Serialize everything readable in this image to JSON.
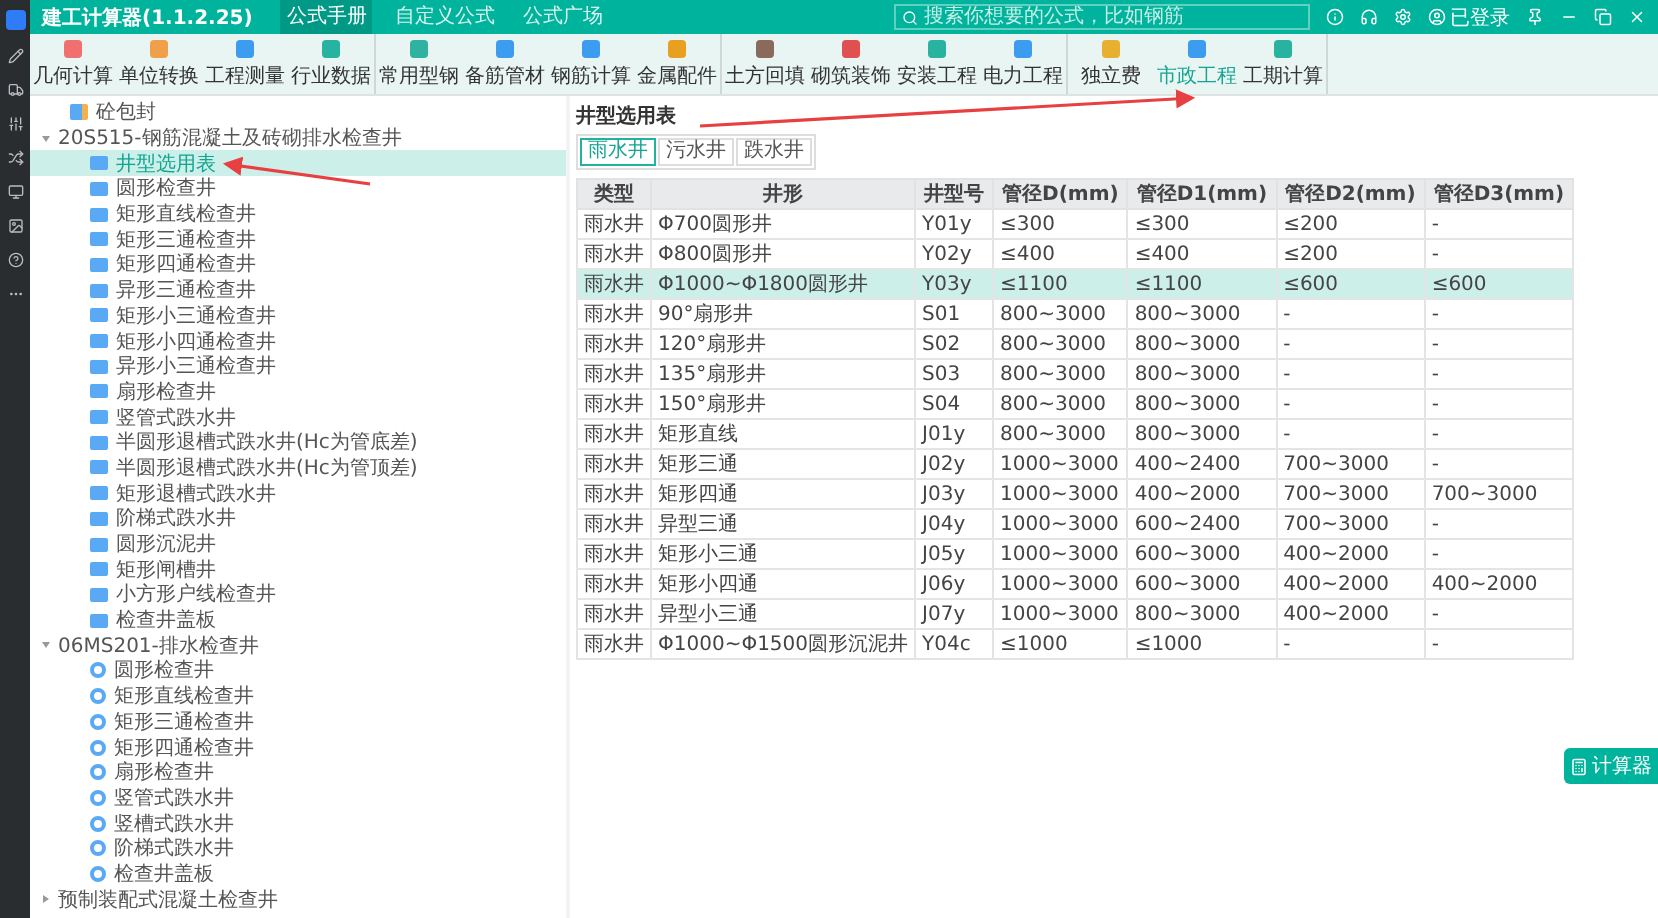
{
  "app": {
    "title": "建工计算器(1.1.2.25)",
    "nav_tabs": [
      {
        "label": "公式手册",
        "selected": true
      },
      {
        "label": "自定义公式",
        "selected": false
      },
      {
        "label": "公式广场",
        "selected": false
      }
    ],
    "search": {
      "placeholder": "搜索你想要的公式，比如钢筋"
    },
    "account": "已登录"
  },
  "toolbar": {
    "groups": [
      {
        "items": [
          {
            "label": "几何计算",
            "selected": false
          },
          {
            "label": "单位转换",
            "selected": false
          },
          {
            "label": "工程测量",
            "selected": false
          },
          {
            "label": "行业数据",
            "selected": false
          }
        ]
      },
      {
        "items": [
          {
            "label": "常用型钢",
            "selected": false
          },
          {
            "label": "备筋管材",
            "selected": false
          },
          {
            "label": "钢筋计算",
            "selected": false
          },
          {
            "label": "金属配件",
            "selected": false
          }
        ]
      },
      {
        "items": [
          {
            "label": "土方回填",
            "selected": false
          },
          {
            "label": "砌筑装饰",
            "selected": false
          },
          {
            "label": "安装工程",
            "selected": false
          },
          {
            "label": "电力工程",
            "selected": false
          }
        ]
      },
      {
        "items": [
          {
            "label": "独立费",
            "selected": false
          },
          {
            "label": "市政工程",
            "selected": true
          },
          {
            "label": "工期计算",
            "selected": false
          }
        ]
      }
    ]
  },
  "tree": [
    {
      "label": "砼包封",
      "kind": "leaf"
    },
    {
      "label": "20S515-钢筋混凝土及砖砌排水检查井",
      "kind": "group",
      "expanded": true,
      "children": [
        {
          "label": "井型选用表",
          "kind": "square",
          "selected": true
        },
        {
          "label": "圆形检查井",
          "kind": "square",
          "selected": false
        },
        {
          "label": "矩形直线检查井",
          "kind": "square",
          "selected": false
        },
        {
          "label": "矩形三通检查井",
          "kind": "square",
          "selected": false
        },
        {
          "label": "矩形四通检查井",
          "kind": "square",
          "selected": false
        },
        {
          "label": "异形三通检查井",
          "kind": "square",
          "selected": false
        },
        {
          "label": "矩形小三通检查井",
          "kind": "square",
          "selected": false
        },
        {
          "label": "矩形小四通检查井",
          "kind": "square",
          "selected": false
        },
        {
          "label": "异形小三通检查井",
          "kind": "square",
          "selected": false
        },
        {
          "label": "扇形检查井",
          "kind": "square",
          "selected": false
        },
        {
          "label": "竖管式跌水井",
          "kind": "square",
          "selected": false
        },
        {
          "label": "半圆形退槽式跌水井(Hc为管底差)",
          "kind": "square",
          "selected": false
        },
        {
          "label": "半圆形退槽式跌水井(Hc为管顶差)",
          "kind": "square",
          "selected": false
        },
        {
          "label": "矩形退槽式跌水井",
          "kind": "square",
          "selected": false
        },
        {
          "label": "阶梯式跌水井",
          "kind": "square",
          "selected": false
        },
        {
          "label": "圆形沉泥井",
          "kind": "square",
          "selected": false
        },
        {
          "label": "矩形闸槽井",
          "kind": "square",
          "selected": false
        },
        {
          "label": "小方形户线检查井",
          "kind": "square",
          "selected": false
        },
        {
          "label": "检查井盖板",
          "kind": "square",
          "selected": false
        }
      ]
    },
    {
      "label": "06MS201-排水检查井",
      "kind": "group",
      "expanded": true,
      "children": [
        {
          "label": "圆形检查井",
          "kind": "round",
          "selected": false
        },
        {
          "label": "矩形直线检查井",
          "kind": "round",
          "selected": false
        },
        {
          "label": "矩形三通检查井",
          "kind": "round",
          "selected": false
        },
        {
          "label": "矩形四通检查井",
          "kind": "round",
          "selected": false
        },
        {
          "label": "扇形检查井",
          "kind": "round",
          "selected": false
        },
        {
          "label": "竖管式跌水井",
          "kind": "round",
          "selected": false
        },
        {
          "label": "竖槽式跌水井",
          "kind": "round",
          "selected": false
        },
        {
          "label": "阶梯式跌水井",
          "kind": "round",
          "selected": false
        },
        {
          "label": "检查井盖板",
          "kind": "round",
          "selected": false
        }
      ]
    },
    {
      "label": "预制装配式混凝土检查井",
      "kind": "group",
      "expanded": false
    }
  ],
  "panel": {
    "title": "井型选用表",
    "tabs": [
      {
        "label": "雨水井",
        "selected": true
      },
      {
        "label": "污水井",
        "selected": false
      },
      {
        "label": "跌水井",
        "selected": false
      }
    ],
    "columns": [
      "类型",
      "井形",
      "井型号",
      "管径D(mm)",
      "管径D1(mm)",
      "管径D2(mm)",
      "管径D3(mm)"
    ],
    "rows": [
      {
        "selected": false,
        "cells": [
          "雨水井",
          "Φ700圆形井",
          "Y01y",
          "≤300",
          "≤300",
          "≤200",
          "-"
        ]
      },
      {
        "selected": false,
        "cells": [
          "雨水井",
          "Φ800圆形井",
          "Y02y",
          "≤400",
          "≤400",
          "≤200",
          "-"
        ]
      },
      {
        "selected": true,
        "cells": [
          "雨水井",
          "Φ1000~Φ1800圆形井",
          "Y03y",
          "≤1100",
          "≤1100",
          "≤600",
          "≤600"
        ]
      },
      {
        "selected": false,
        "cells": [
          "雨水井",
          "90°扇形井",
          "S01",
          "800~3000",
          "800~3000",
          "-",
          "-"
        ]
      },
      {
        "selected": false,
        "cells": [
          "雨水井",
          "120°扇形井",
          "S02",
          "800~3000",
          "800~3000",
          "-",
          "-"
        ]
      },
      {
        "selected": false,
        "cells": [
          "雨水井",
          "135°扇形井",
          "S03",
          "800~3000",
          "800~3000",
          "-",
          "-"
        ]
      },
      {
        "selected": false,
        "cells": [
          "雨水井",
          "150°扇形井",
          "S04",
          "800~3000",
          "800~3000",
          "-",
          "-"
        ]
      },
      {
        "selected": false,
        "cells": [
          "雨水井",
          "矩形直线",
          "J01y",
          "800~3000",
          "800~3000",
          "-",
          "-"
        ]
      },
      {
        "selected": false,
        "cells": [
          "雨水井",
          "矩形三通",
          "J02y",
          "1000~3000",
          "400~2400",
          "700~3000",
          "-"
        ]
      },
      {
        "selected": false,
        "cells": [
          "雨水井",
          "矩形四通",
          "J03y",
          "1000~3000",
          "400~2000",
          "700~3000",
          "700~3000"
        ]
      },
      {
        "selected": false,
        "cells": [
          "雨水井",
          "异型三通",
          "J04y",
          "1000~3000",
          "600~2400",
          "700~3000",
          "-"
        ]
      },
      {
        "selected": false,
        "cells": [
          "雨水井",
          "矩形小三通",
          "J05y",
          "1000~3000",
          "600~3000",
          "400~2000",
          "-"
        ]
      },
      {
        "selected": false,
        "cells": [
          "雨水井",
          "矩形小四通",
          "J06y",
          "1000~3000",
          "600~3000",
          "400~2000",
          "400~2000"
        ]
      },
      {
        "selected": false,
        "cells": [
          "雨水井",
          "异型小三通",
          "J07y",
          "1000~3000",
          "800~3000",
          "400~2000",
          "-"
        ]
      },
      {
        "selected": false,
        "cells": [
          "雨水井",
          "Φ1000~Φ1500圆形沉泥井",
          "Y04c",
          "≤1000",
          "≤1000",
          "-",
          "-"
        ]
      }
    ]
  },
  "float_button": "计算器"
}
